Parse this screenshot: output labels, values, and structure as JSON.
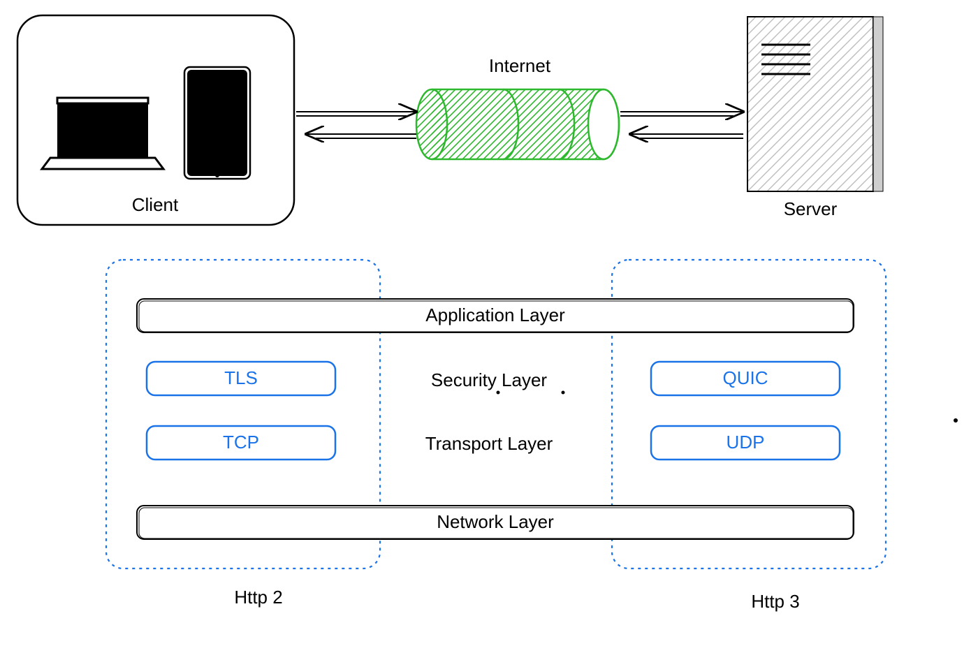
{
  "top": {
    "client_label": "Client",
    "internet_label": "Internet",
    "server_label": "Server"
  },
  "stack": {
    "app_layer": "Application Layer",
    "security_layer": "Security Layer",
    "transport_layer": "Transport Layer",
    "network_layer": "Network Layer",
    "http2": {
      "label": "Http 2",
      "security": "TLS",
      "transport": "TCP"
    },
    "http3": {
      "label": "Http 3",
      "security": "QUIC",
      "transport": "UDP"
    }
  }
}
